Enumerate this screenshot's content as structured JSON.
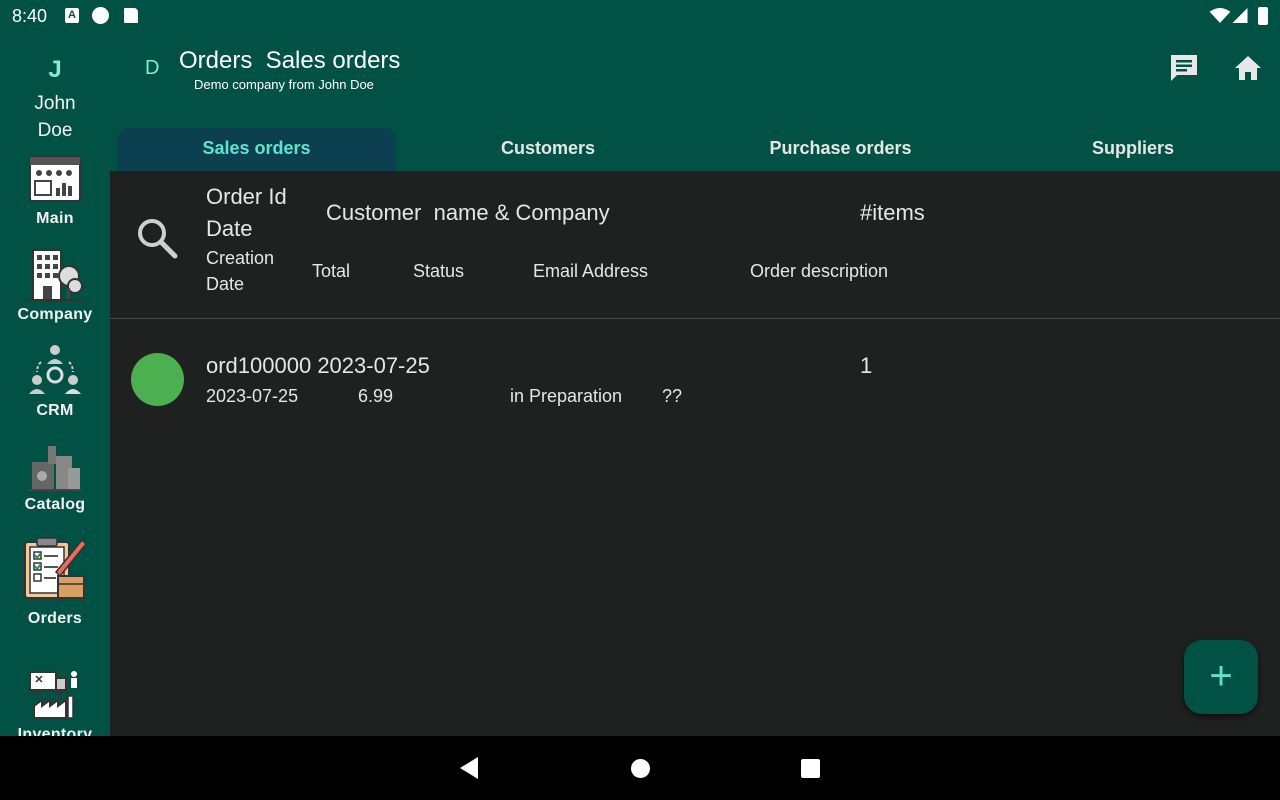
{
  "status_bar": {
    "time": "8:40",
    "a_badge": "A"
  },
  "rail": {
    "avatar_letter": "J",
    "user_first": "John",
    "user_last": "Doe",
    "items": [
      {
        "label": "Main",
        "icon": "dashboard-icon"
      },
      {
        "label": "Company",
        "icon": "company-building-icon"
      },
      {
        "label": "CRM",
        "icon": "crm-people-icon"
      },
      {
        "label": "Catalog",
        "icon": "catalog-products-icon"
      },
      {
        "label": "Orders",
        "icon": "orders-clipboard-icon"
      },
      {
        "label": "Inventory",
        "icon": "inventory-warehouse-icon"
      }
    ]
  },
  "appbar": {
    "company_letter": "D",
    "title": "Orders  Sales orders",
    "subtitle": "Demo company from John Doe"
  },
  "tabs": [
    {
      "label": "Sales orders",
      "active": true
    },
    {
      "label": "Customers",
      "active": false
    },
    {
      "label": "Purchase orders",
      "active": false
    },
    {
      "label": "Suppliers",
      "active": false
    }
  ],
  "header": {
    "order_id": "Order Id",
    "date": "Date",
    "customer": "Customer  name & Company",
    "items": "#items",
    "creation": "Creation",
    "creation_date": "Date",
    "total": "Total",
    "status": "Status",
    "email": "Email Address",
    "description": "Order description"
  },
  "orders": [
    {
      "id_date": "ord100000 2023-07-25",
      "items": "1",
      "creation_date": "2023-07-25",
      "total": "6.99",
      "status": "in Preparation",
      "email": "??"
    }
  ],
  "colors": {
    "primary": "#015244",
    "accent": "#5fe3cc",
    "active_tab": "#0c3f4f",
    "status_dot": "#4caf50",
    "background": "#1f2020"
  },
  "fab": {
    "label": "+"
  }
}
